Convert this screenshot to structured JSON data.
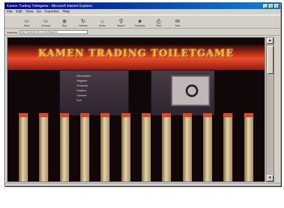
{
  "window": {
    "title": "Kamen Trading Toiletgame - Microsoft Internet Explorer",
    "controls": [
      "_",
      "□",
      "×"
    ]
  },
  "menu": [
    "File",
    "Edit",
    "View",
    "Go",
    "Favorites",
    "Help"
  ],
  "toolbar": [
    {
      "label": "Back",
      "icon": "back-arrow-icon"
    },
    {
      "label": "Forward",
      "icon": "forward-arrow-icon"
    },
    {
      "label": "Stop",
      "icon": "stop-icon"
    },
    {
      "label": "Refresh",
      "icon": "refresh-icon"
    },
    {
      "label": "Home",
      "icon": "home-icon"
    },
    {
      "label": "Search",
      "icon": "search-icon"
    },
    {
      "label": "Favorites",
      "icon": "favorites-icon"
    },
    {
      "label": "Print",
      "icon": "print-icon"
    },
    {
      "label": "Mail",
      "icon": "mail-icon"
    }
  ],
  "address": {
    "label": "Address",
    "value": "http://www.kamen.com/toiletgame/"
  },
  "page": {
    "site_title": "KAMEN TRADING TOILETGAME",
    "nav": [
      "Information",
      "Register",
      "Products",
      "Dealers",
      "Contact",
      "Exit"
    ]
  },
  "colors": {
    "banner": "#c8301c",
    "title": "#f6b23a",
    "background": "#120708"
  }
}
